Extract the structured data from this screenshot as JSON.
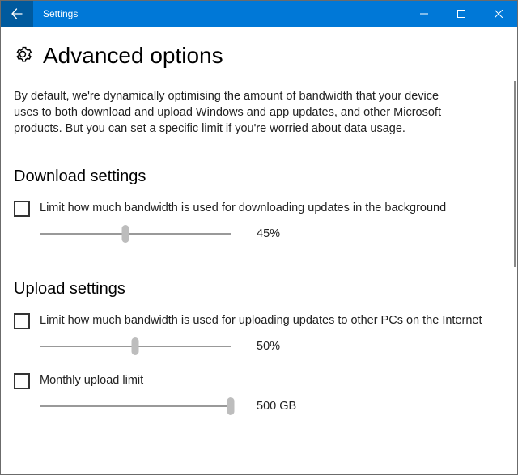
{
  "window": {
    "title": "Settings"
  },
  "page": {
    "title": "Advanced options",
    "description": "By default, we're dynamically optimising the amount of bandwidth that your device uses to both download and upload Windows and app updates, and other Microsoft products. But you can set a specific limit if you're worried about data usage."
  },
  "download": {
    "heading": "Download settings",
    "limit_label": "Limit how much bandwidth is used for downloading updates in the background",
    "slider_percent": 45,
    "slider_display": "45%"
  },
  "upload": {
    "heading": "Upload settings",
    "limit_label": "Limit how much bandwidth is used for uploading updates to other PCs on the Internet",
    "slider_percent": 50,
    "slider_display": "50%",
    "monthly_label": "Monthly upload limit",
    "monthly_slider_percent": 100,
    "monthly_display": "500 GB"
  },
  "colors": {
    "titlebar": "#0078d7",
    "back": "#005a9e"
  }
}
